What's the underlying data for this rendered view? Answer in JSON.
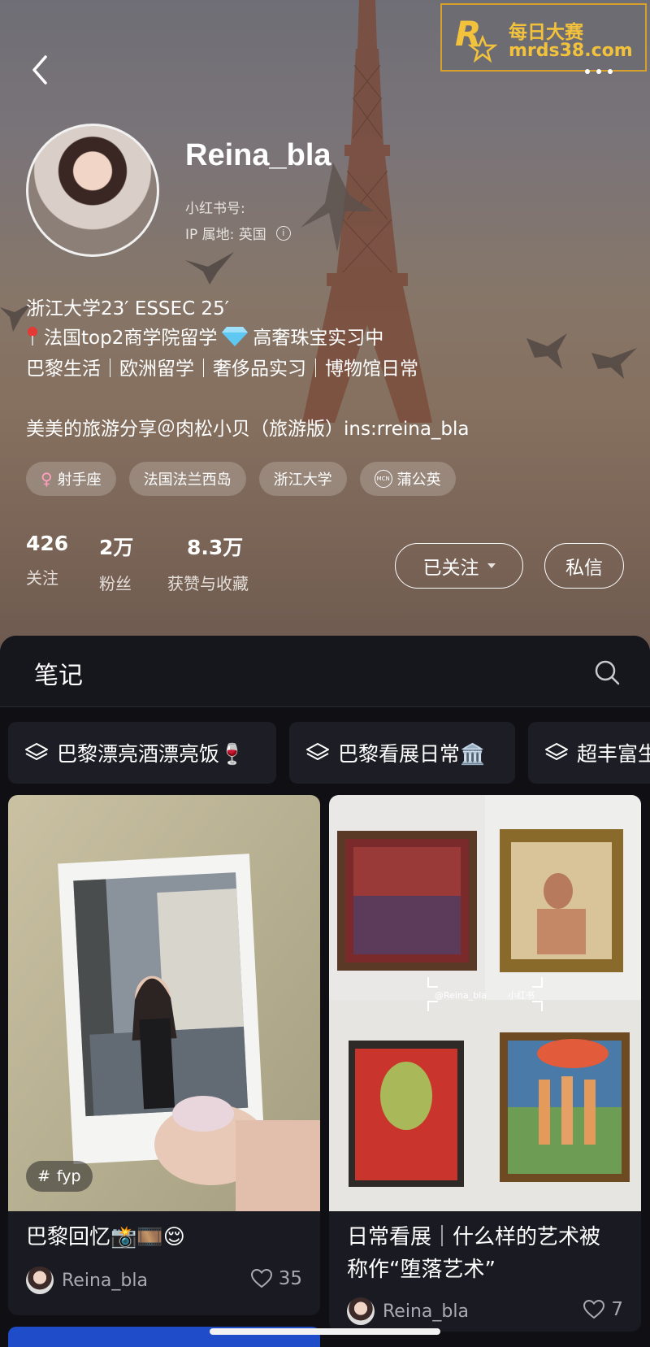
{
  "watermark": {
    "line1": "每日大赛",
    "line2": "mrds38.com",
    "logo_letter": "R",
    "logo_sub": "每日大赛"
  },
  "profile": {
    "username": "Reina_bla",
    "red_id_label": "小红书号:",
    "ip_label": "IP 属地: 英国",
    "bio_line1": "浙江大学23′ ESSEC 25′",
    "bio_line2a": "法国top2商学院留学",
    "bio_line2b": "高奢珠宝实习中",
    "bio_line3": "巴黎生活｜欧洲留学｜奢侈品实习｜博物馆日常",
    "bio_line4": "美美的旅游分享＠肉松小贝（旅游版）ins:rreina_bla"
  },
  "tags": [
    {
      "label": "射手座",
      "icon": "female-icon"
    },
    {
      "label": "法国法兰西岛"
    },
    {
      "label": "浙江大学"
    },
    {
      "label": "蒲公英",
      "icon": "mcn-icon",
      "icon_text": "MCN"
    }
  ],
  "stats": [
    {
      "value": "426",
      "label": "关注"
    },
    {
      "value": "2万",
      "label": "粉丝"
    },
    {
      "value": "8.3万",
      "label": "获赞与收藏"
    }
  ],
  "actions": {
    "follow_label": "已关注",
    "message_label": "私信"
  },
  "notes": {
    "title": "笔记"
  },
  "collections": [
    {
      "label": "巴黎漂亮酒漂亮饭🍷"
    },
    {
      "label": "巴黎看展日常🏛️"
    },
    {
      "label": "超丰富生"
    }
  ],
  "cards": [
    {
      "title": "巴黎回忆📸🎞️😌",
      "user": "Reina_bla",
      "likes": "35",
      "topic_tag": "fyp"
    },
    {
      "title_line1": "日常看展｜什么样的艺术被",
      "title_line2": "称作“堕落艺术”",
      "user": "Reina_bla",
      "likes": "7",
      "watermark_user": "@Reina_bla",
      "watermark_app": "小红书"
    }
  ],
  "colors": {
    "background": "#0f0f14",
    "panel_header": "#16161d",
    "accent_gold": "#f2c23c"
  }
}
